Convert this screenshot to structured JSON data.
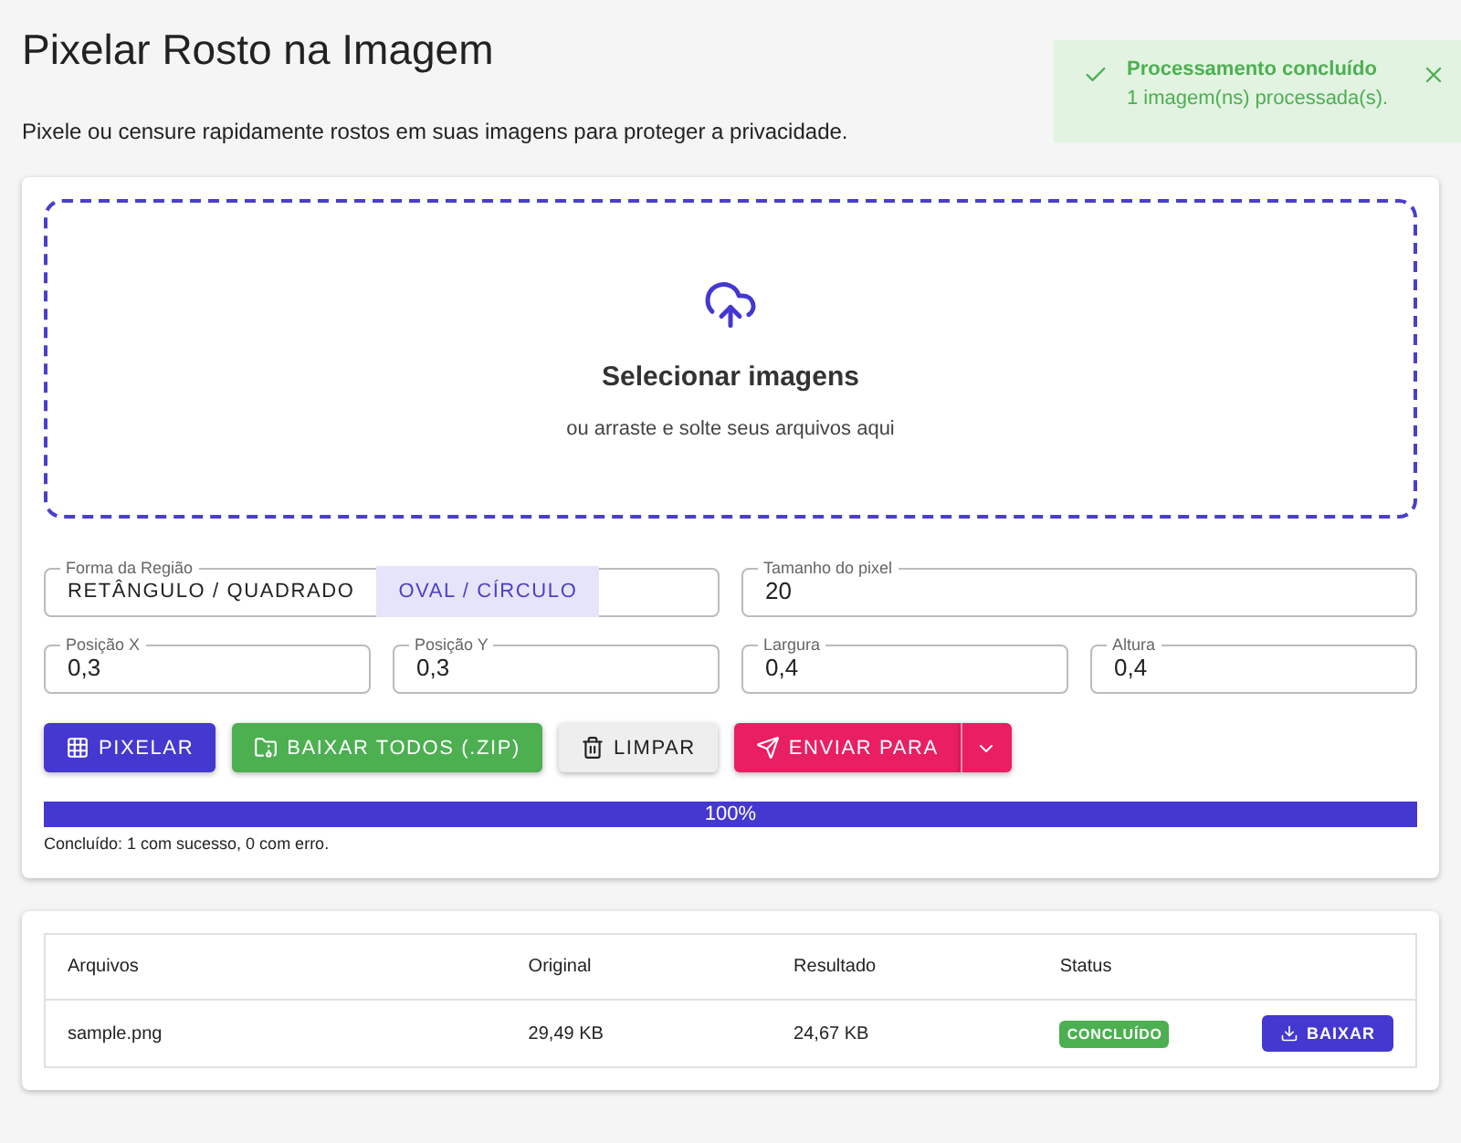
{
  "title": "Pixelar Rosto na Imagem",
  "subtitle": "Pixele ou censure rapidamente rostos em suas imagens para proteger a privacidade.",
  "toast": {
    "title": "Processamento concluído",
    "message": "1 imagem(ns) processada(s)."
  },
  "dropzone": {
    "title": "Selecionar imagens",
    "hint": "ou arraste e solte seus arquivos aqui"
  },
  "shape": {
    "label": "Forma da Região",
    "options": [
      {
        "label": "RETÂNGULO / QUADRADO",
        "selected": false
      },
      {
        "label": "OVAL / CÍRCULO",
        "selected": true
      }
    ]
  },
  "pixel_size": {
    "label": "Tamanho do pixel",
    "value": "20"
  },
  "fields": [
    {
      "label": "Posição X",
      "value": "0,3"
    },
    {
      "label": "Posição Y",
      "value": "0,3"
    },
    {
      "label": "Largura",
      "value": "0,4"
    },
    {
      "label": "Altura",
      "value": "0,4"
    }
  ],
  "buttons": [
    {
      "kind": "pixelate",
      "label": "PIXELAR"
    },
    {
      "kind": "zip",
      "label": "BAIXAR TODOS (.ZIP)"
    },
    {
      "kind": "clear",
      "label": "LIMPAR"
    },
    {
      "kind": "send",
      "label": "ENVIAR PARA"
    }
  ],
  "progress": {
    "level": 1,
    "text": "100%"
  },
  "summary": "Concluído: 1 com sucesso, 0 com erro.",
  "table": {
    "columns": [
      "Arquivos",
      "Original",
      "Resultado",
      "Status"
    ],
    "rows": [
      {
        "file": "sample.png",
        "original": "29,49 KB",
        "result": "24,67 KB",
        "status": "CONCLUÍDO",
        "action": "BAIXAR"
      }
    ]
  }
}
